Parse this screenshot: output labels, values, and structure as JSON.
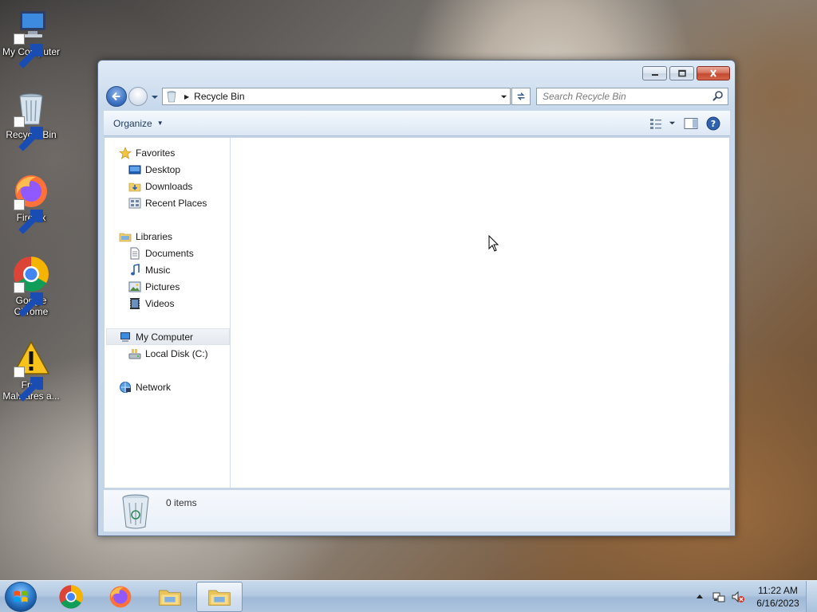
{
  "desktop": {
    "icons": [
      {
        "label": "My Computer",
        "icon": "my-computer-icon"
      },
      {
        "label": "Recycle Bin",
        "icon": "recycle-bin-icon"
      },
      {
        "label": "Firefox",
        "icon": "firefox-icon"
      },
      {
        "label": "Google Chrome",
        "icon": "chrome-icon"
      },
      {
        "label": "Free Malwares a...",
        "icon": "warning-icon"
      }
    ]
  },
  "window": {
    "address": {
      "path": "Recycle Bin"
    },
    "search": {
      "placeholder": "Search Recycle Bin"
    },
    "toolbar": {
      "organize_label": "Organize"
    },
    "nav": {
      "favorites": {
        "label": "Favorites",
        "items": [
          "Desktop",
          "Downloads",
          "Recent Places"
        ]
      },
      "libraries": {
        "label": "Libraries",
        "items": [
          "Documents",
          "Music",
          "Pictures",
          "Videos"
        ]
      },
      "computer": {
        "label": "My Computer",
        "items": [
          "Local Disk (C:)"
        ]
      },
      "network": {
        "label": "Network"
      }
    },
    "details": {
      "item_count": "0 items"
    }
  },
  "taskbar": {
    "pinned": [
      "chrome-icon",
      "firefox-icon",
      "explorer-icon",
      "explorer-icon"
    ],
    "clock": {
      "time": "11:22 AM",
      "date": "6/16/2023"
    }
  },
  "colors": {
    "accent": "#3f74c4",
    "close_button": "#c44a30",
    "taskbar": "#b3c9e1"
  }
}
